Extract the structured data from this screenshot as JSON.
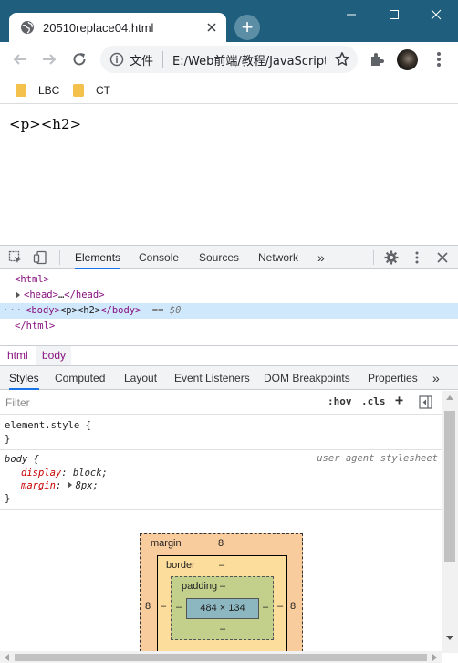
{
  "browser": {
    "tab_title": "20510replace04.html",
    "new_tab": "+",
    "url_scheme": "文件",
    "url": "E:/Web前端/教程/JavaScript/"
  },
  "bookmarks": [
    {
      "label": "LBC"
    },
    {
      "label": "CT"
    }
  ],
  "page": {
    "text": "<p><h2>"
  },
  "devtools": {
    "tabs": [
      "Elements",
      "Console",
      "Sources",
      "Network"
    ],
    "more_tabs": "»",
    "dom": {
      "html_open": "<html>",
      "head_open": "<head>",
      "head_ellipsis": "…",
      "head_close": "</head>",
      "body_open": "<body>",
      "body_text": "<p><h2>",
      "body_close": "</body>",
      "body_marker": "== $0",
      "html_close": "</html>",
      "dots": "···"
    },
    "breadcrumbs": [
      "html",
      "body"
    ],
    "subtabs": [
      "Styles",
      "Computed",
      "Layout",
      "Event Listeners",
      "DOM Breakpoints",
      "Properties"
    ],
    "subtabs_more": "»",
    "filter_placeholder": "Filter",
    "hov": ":hov",
    "cls": ".cls",
    "plus": "+",
    "element_style": {
      "selector": "element.style {",
      "close": "}"
    },
    "body_rule": {
      "selector": "body {",
      "origin": "user agent stylesheet",
      "display_prop": "display",
      "display_val": "block;",
      "margin_prop": "margin",
      "margin_val": "8px;",
      "close": "}"
    },
    "box_model": {
      "margin_label": "margin",
      "margin_top": "8",
      "margin_left": "8",
      "margin_right": "8",
      "border_label": "border",
      "border_top": "–",
      "border_left": "–",
      "border_right": "–",
      "padding_label": "padding",
      "padding_top": "–",
      "padding_left": "–",
      "padding_right": "–",
      "padding_bottom": "–",
      "content": "484 × 134"
    }
  }
}
